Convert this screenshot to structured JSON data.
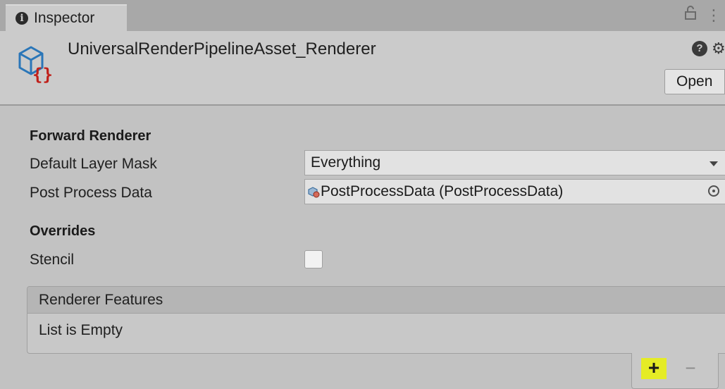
{
  "tab": {
    "label": "Inspector"
  },
  "header": {
    "asset_name": "UniversalRenderPipelineAsset_Renderer",
    "open_label": "Open"
  },
  "forward_renderer": {
    "title": "Forward Renderer",
    "default_layer_mask": {
      "label": "Default Layer Mask",
      "value": "Everything"
    },
    "post_process_data": {
      "label": "Post Process Data",
      "value": "PostProcessData (PostProcessData)"
    }
  },
  "overrides": {
    "title": "Overrides",
    "stencil": {
      "label": "Stencil",
      "checked": false
    }
  },
  "renderer_features": {
    "header": "Renderer Features",
    "empty_text": "List is Empty",
    "add_label": "+",
    "remove_label": "−"
  },
  "icons": {
    "tab": "info-icon",
    "lock": "lock-icon",
    "menu": "kebab-menu-icon",
    "asset": "script-asset-icon",
    "help": "help-icon",
    "settings": "settings-icon",
    "object": "post-process-data-icon",
    "picker": "object-picker-icon"
  },
  "colors": {
    "add_highlight": "#e5ec26",
    "asset_brace": "#c0201a",
    "asset_cube": "#2a76b8"
  }
}
